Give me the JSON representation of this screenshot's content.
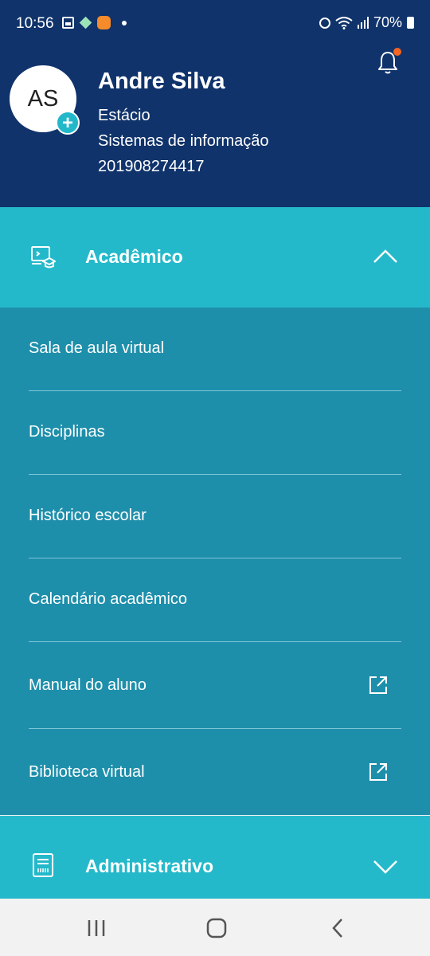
{
  "status_bar": {
    "time": "10:56",
    "battery": "70%"
  },
  "profile": {
    "initials": "AS",
    "name": "Andre Silva",
    "institution": "Estácio",
    "course": "Sistemas de informação",
    "registration": "201908274417"
  },
  "academic": {
    "title": "Acadêmico",
    "items": [
      {
        "label": "Sala de aula virtual"
      },
      {
        "label": "Disciplinas"
      },
      {
        "label": "Histórico escolar"
      },
      {
        "label": "Calendário acadêmico"
      },
      {
        "label": "Manual do aluno"
      },
      {
        "label": "Biblioteca virtual"
      }
    ]
  },
  "administrative": {
    "title": "Administrativo"
  },
  "colors": {
    "header": "#10336b",
    "section": "#24b9ca",
    "submenu": "#1e8fab",
    "notification_dot": "#f26522"
  }
}
